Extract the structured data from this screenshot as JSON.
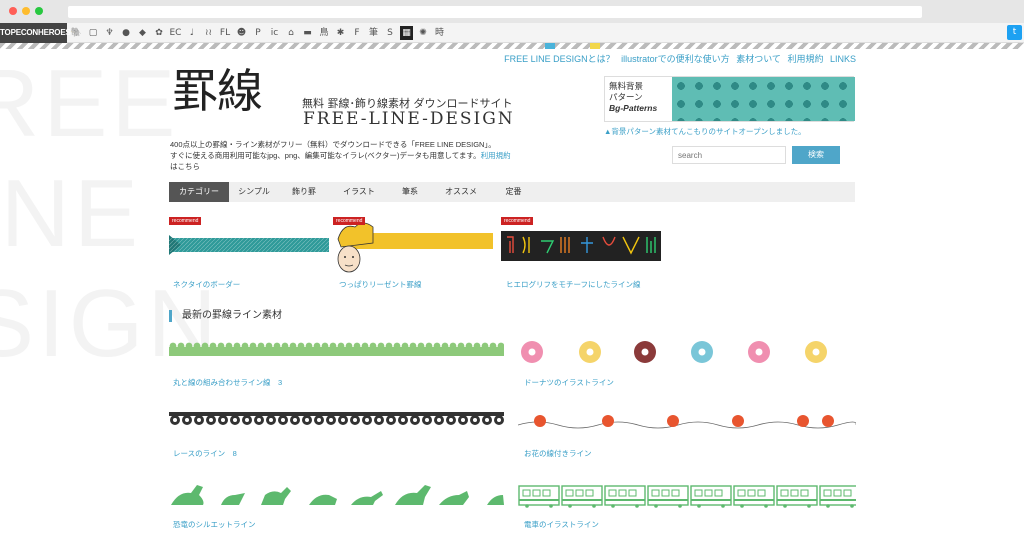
{
  "toolbar": {
    "brand": "TOPECONHEROES",
    "icons": [
      "🐘",
      "▢",
      "♆",
      "●",
      "◆",
      "✿",
      "EC",
      "♩",
      "≀≀",
      "FL",
      "☻",
      "P",
      "ic",
      "⌂",
      "▬",
      "鳥",
      "✱",
      "F",
      "筆",
      "S",
      "▦",
      "✺",
      "時"
    ],
    "twitter": "t"
  },
  "header": {
    "top_links": [
      "FREE LINE DESIGNとは？",
      "illustratorでの便利な使い方",
      "素材ついて",
      "利用規約",
      "LINKS"
    ],
    "logo_kanji": "罫線",
    "subtitle": "無料 罫線･飾り線素材 ダウンロードサイト",
    "logo_en": "FREE-LINE-DESIGN",
    "description_1": "400点以上の罫線・ライン素材がフリー（無料）でダウンロードできる「FREE LINE DESIGN」。",
    "description_2": "すぐに使える商用利用可能なjpg、png、編集可能なイラレ(ベクター)データも用意してます。",
    "description_link": "利用規約",
    "description_3": "はこちら",
    "banner_line1": "無料背景",
    "banner_line2": "パターン",
    "banner_line3": "Bg-Patterns",
    "banner_note": "▲背景パターン素材てんこもりのサイトオープンしました。",
    "search_placeholder": "search",
    "search_button": "検索"
  },
  "watermark": "REE\nINE\nSIGN",
  "nav": [
    "カテゴリー",
    "シンプル",
    "飾り罫",
    "イラスト",
    "筆系",
    "オススメ",
    "定番"
  ],
  "featured": {
    "tag": "recommend",
    "items": [
      "ネクタイのボーダー",
      "つっぱりリーゼント罫線",
      "ヒエログリフをモチーフにしたライン線"
    ]
  },
  "section_title": "最新の罫線ライン素材",
  "items": [
    "丸と線の組み合わせライン線　3",
    "ドーナツのイラストライン",
    "レースのライン　8",
    "お花の線付きライン",
    "恐竜のシルエットライン",
    "電車のイラストライン"
  ],
  "colors": {
    "accent": "#4fa6c9",
    "link": "#3a9fc7",
    "green": "#8dc97a",
    "red": "#cc2222"
  }
}
